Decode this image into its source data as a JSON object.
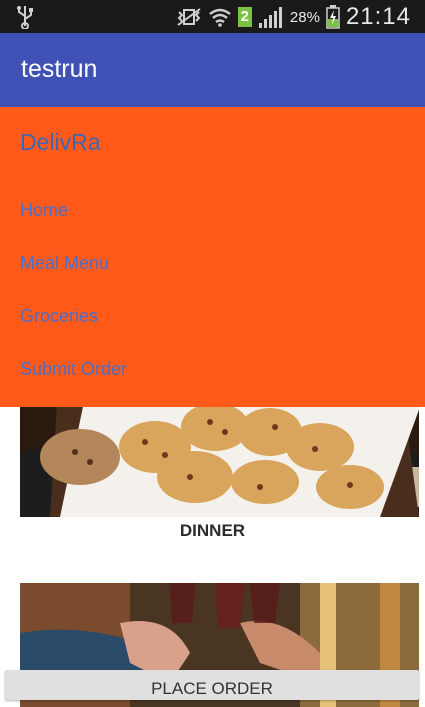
{
  "status_bar": {
    "sim_badge": "2",
    "battery_percent": "28%",
    "time": "21:14"
  },
  "app_bar": {
    "title": "testrun"
  },
  "drawer": {
    "brand": "DelivRa",
    "items": [
      {
        "label": "Home"
      },
      {
        "label": "Meal Menu"
      },
      {
        "label": "Groceries"
      },
      {
        "label": "Submit Order"
      }
    ]
  },
  "content": {
    "section_label": "DINNER",
    "place_order_label": "PLACE ORDER"
  },
  "colors": {
    "status_bar": "#1a1a1a",
    "app_bar": "#3f51b5",
    "drawer_bg": "#ff5a19",
    "drawer_text": "#4a6fc8"
  }
}
